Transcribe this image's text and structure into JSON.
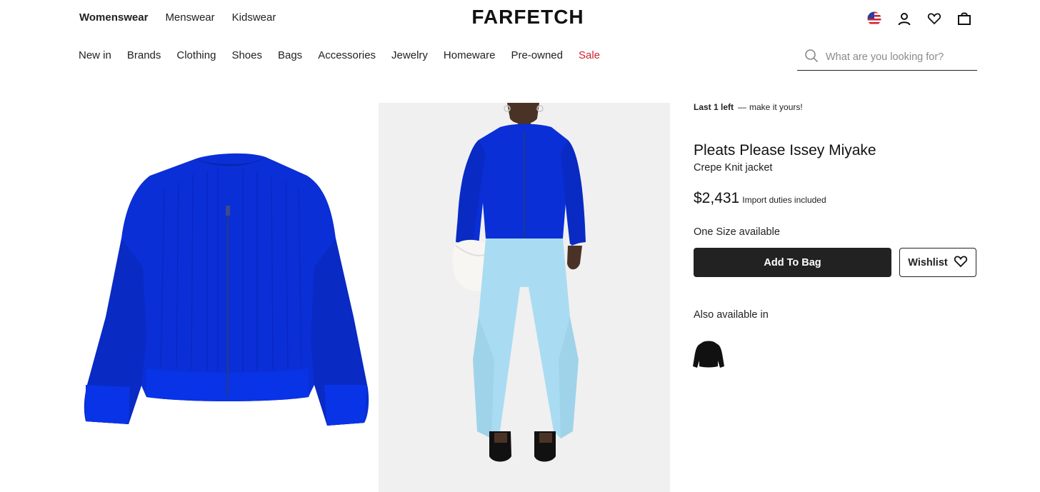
{
  "header": {
    "logo": "FARFETCH",
    "gender_tabs": [
      {
        "label": "Womenswear"
      },
      {
        "label": "Menswear"
      },
      {
        "label": "Kidswear"
      }
    ],
    "categories": [
      {
        "label": "New in"
      },
      {
        "label": "Brands"
      },
      {
        "label": "Clothing"
      },
      {
        "label": "Shoes"
      },
      {
        "label": "Bags"
      },
      {
        "label": "Accessories"
      },
      {
        "label": "Jewelry"
      },
      {
        "label": "Homeware"
      },
      {
        "label": "Pre-owned"
      },
      {
        "label": "Sale"
      }
    ],
    "search": {
      "placeholder": "What are you looking for?"
    },
    "icons": [
      "us-flag-icon",
      "account-icon",
      "wishlist-heart-icon",
      "shopping-bag-icon"
    ]
  },
  "product": {
    "stock_bold": "Last 1 left",
    "stock_sep": "—",
    "stock_rest": "make it yours!",
    "brand": "Pleats Please Issey Miyake",
    "name": "Crepe Knit jacket",
    "price": "$2,431",
    "duties": "Import duties included",
    "size_text": "One Size available",
    "add_to_bag": "Add To Bag",
    "wishlist": "Wishlist",
    "also_available": "Also available in",
    "colors": {
      "jacket_blue": "#0a2fd6",
      "trousers_light_blue": "#a9dcf2",
      "variant_black": "#111111",
      "sale_red": "#d1222f"
    }
  }
}
